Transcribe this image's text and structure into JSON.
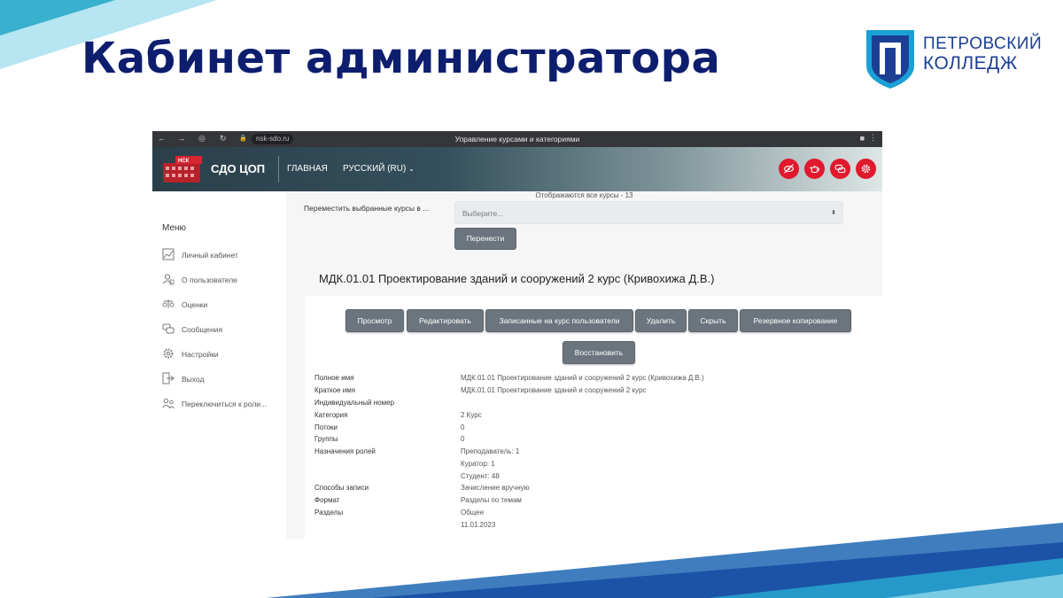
{
  "slide": {
    "title": "Кабинет администратора",
    "logo": {
      "line1": "ПЕТРОВСКИЙ",
      "line2": "КОЛЛЕДЖ",
      "color": "#1c3f94"
    }
  },
  "browser": {
    "url": "nsk-sdo.ru",
    "tab_title": "Управление курсами и категориями"
  },
  "app": {
    "brand_logo_text": "НСК",
    "brand": "СДО ЦОП",
    "nav": {
      "home": "ГЛАВНАЯ",
      "language": "РУССКИЙ (RU)"
    },
    "header_icons": [
      "eye-slash-icon",
      "teapot-icon",
      "chat-icon",
      "gear-icon"
    ],
    "accent_color": "#e0192d"
  },
  "sidebar": {
    "title": "Меню",
    "items": [
      {
        "label": "Личный кабинет",
        "icon": "dashboard-icon"
      },
      {
        "label": "О пользователе",
        "icon": "user-icon"
      },
      {
        "label": "Оценки",
        "icon": "grades-icon"
      },
      {
        "label": "Сообщения",
        "icon": "messages-icon"
      },
      {
        "label": "Настройки",
        "icon": "settings-icon"
      },
      {
        "label": "Выход",
        "icon": "logout-icon"
      },
      {
        "label": "Переключиться к роли...",
        "icon": "switch-role-icon"
      }
    ]
  },
  "content": {
    "shown_count": "Отображаются все курсы - 13",
    "move_label": "Переместить выбранные курсы в ...",
    "move_select_placeholder": "Выберите...",
    "move_button": "Перенести",
    "course_title": "МДК.01.01 Проектирование зданий и сооружений 2 курс (Кривохижа Д.В.)",
    "actions": [
      "Просмотр",
      "Редактировать",
      "Записанные на курс пользователи",
      "Удалить",
      "Скрыть",
      "Резервное копирование",
      "Восстановить"
    ],
    "details": [
      {
        "label": "Полное имя",
        "value": "МДК.01.01 Проектирование зданий и сооружений 2 курс (Кривохижа Д.В.)"
      },
      {
        "label": "Краткое имя",
        "value": "МДК.01.01 Проектирование зданий и сооружений 2 курс"
      },
      {
        "label": "Индивидуальный номер",
        "value": ""
      },
      {
        "label": "Категория",
        "value": "2 Курс"
      },
      {
        "label": "Потоки",
        "value": "0"
      },
      {
        "label": "Группы",
        "value": "0"
      },
      {
        "label": "Назначения ролей",
        "value": "Преподаватель: 1"
      },
      {
        "label": "",
        "value": "Куратор: 1"
      },
      {
        "label": "",
        "value": "Студент: 48"
      },
      {
        "label": "Способы записи",
        "value": "Зачисление вручную"
      },
      {
        "label": "Формат",
        "value": "Разделы по темам"
      },
      {
        "label": "Разделы",
        "value": "Общее"
      },
      {
        "label": "",
        "value": "11.01.2023"
      }
    ]
  }
}
